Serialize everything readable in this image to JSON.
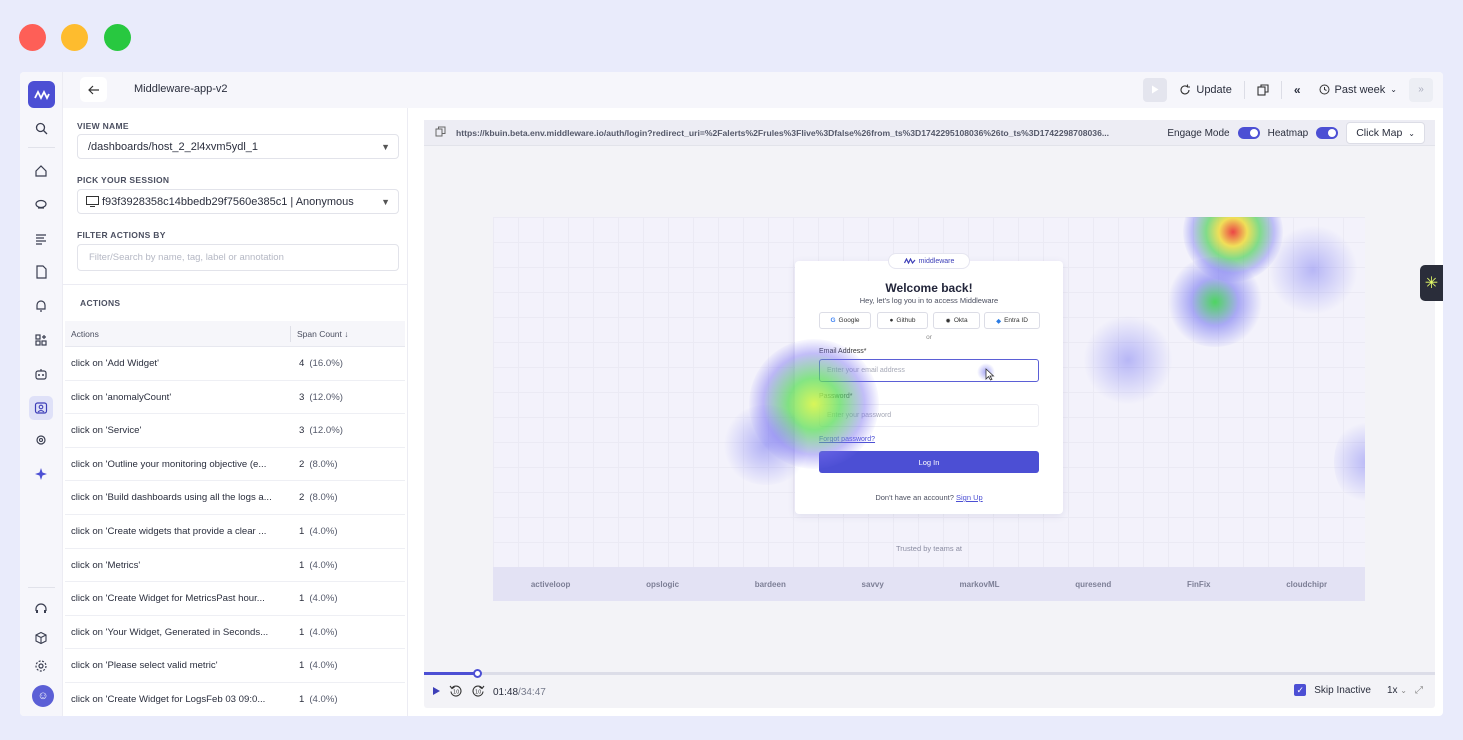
{
  "window": {
    "title": "Middleware-app-v2"
  },
  "toolbar": {
    "update_label": "Update",
    "range_label": "Past week"
  },
  "sidebar": {
    "icons": [
      "logo-icon",
      "search-icon",
      "home-icon",
      "infrastructure-icon",
      "logs-icon",
      "apm-icon",
      "alerts-icon",
      "dashboards-icon",
      "bot-icon",
      "rum-icon",
      "settings-cog-icon",
      "ai-sparkle-icon",
      "support-icon",
      "package-icon",
      "gear-icon"
    ]
  },
  "panel": {
    "view_name_label": "VIEW NAME",
    "view_name_value": "/dashboards/host_2_2l4xvm5ydl_1",
    "session_label": "PICK YOUR SESSION",
    "session_value": "f93f3928358c14bbedb29f7560e385c1 | Anonymous",
    "filter_label": "FILTER ACTIONS BY",
    "filter_placeholder": "Filter/Search by name, tag, label or annotation",
    "actions_title": "ACTIONS",
    "table": {
      "col_actions": "Actions",
      "col_span": "Span Count",
      "rows": [
        {
          "action": "click on 'Add Widget'",
          "count": "4",
          "pct": "(16.0%)"
        },
        {
          "action": "click on 'anomalyCount'",
          "count": "3",
          "pct": "(12.0%)"
        },
        {
          "action": "click on 'Service'",
          "count": "3",
          "pct": "(12.0%)"
        },
        {
          "action": "click on 'Outline your monitoring objective (e...",
          "count": "2",
          "pct": "(8.0%)"
        },
        {
          "action": "click on 'Build dashboards using all the logs a...",
          "count": "2",
          "pct": "(8.0%)"
        },
        {
          "action": "click on 'Create widgets that provide a clear ...",
          "count": "1",
          "pct": "(4.0%)"
        },
        {
          "action": "click on 'Metrics'",
          "count": "1",
          "pct": "(4.0%)"
        },
        {
          "action": "click on 'Create Widget for MetricsPast hour...",
          "count": "1",
          "pct": "(4.0%)"
        },
        {
          "action": "click on 'Your Widget, Generated in Seconds...",
          "count": "1",
          "pct": "(4.0%)"
        },
        {
          "action": "click on 'Please select valid metric'",
          "count": "1",
          "pct": "(4.0%)"
        },
        {
          "action": "click on 'Create Widget for LogsFeb 03 09:0...",
          "count": "1",
          "pct": "(4.0%)"
        }
      ]
    }
  },
  "viewer": {
    "url": "https://kbuin.beta.env.middleware.io/auth/login?redirect_uri=%2Falerts%2Frules%3Flive%3Dfalse%26from_ts%3D1742295108036%26to_ts%3D1742298708036...",
    "engage_mode_label": "Engage Mode",
    "heatmap_label": "Heatmap",
    "click_map_label": "Click Map",
    "replay": {
      "brand": "middleware",
      "welcome": "Welcome back!",
      "subtitle": "Hey, let's log you in to access Middleware",
      "sso": [
        "Google",
        "Github",
        "Okta",
        "Entra ID"
      ],
      "or": "or",
      "email_label": "Email Address*",
      "email_placeholder": "Enter your email address",
      "password_label": "Password*",
      "password_placeholder": "Enter your password",
      "forgot": "Forgot password?",
      "login": "Log In",
      "no_account": "Don't have an account?",
      "signup": "Sign Up",
      "trusted": "Trusted by teams at",
      "logos": [
        "activeloop",
        "opslogic",
        "bardeen",
        "savvy",
        "markovML",
        "quresend",
        "FinFix",
        "cloudchipr"
      ]
    },
    "playback": {
      "progress": 0.052,
      "current": "01:48",
      "total": "34:47",
      "skip_inactive": "Skip Inactive",
      "speed": "1x"
    }
  }
}
